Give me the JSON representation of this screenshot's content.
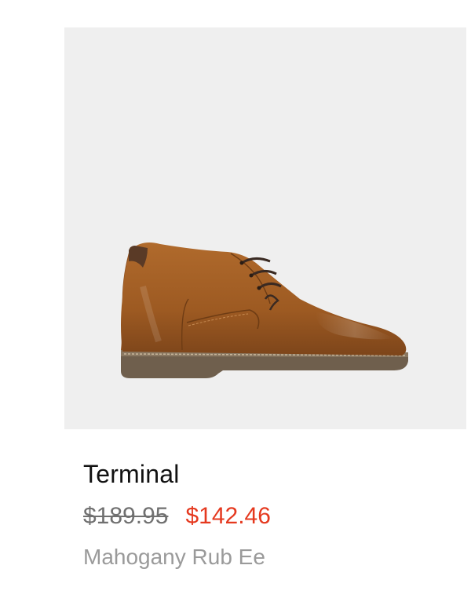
{
  "product": {
    "name": "Terminal",
    "original_price": "$189.95",
    "sale_price": "$142.46",
    "color_name": "Mahogany Rub Ee",
    "image_alt": "chukka-boot-image",
    "colors": {
      "image_background": "#efefef",
      "sale_price": "#e5391f",
      "original_price": "#707070",
      "color_name": "#9a9a9a"
    }
  }
}
